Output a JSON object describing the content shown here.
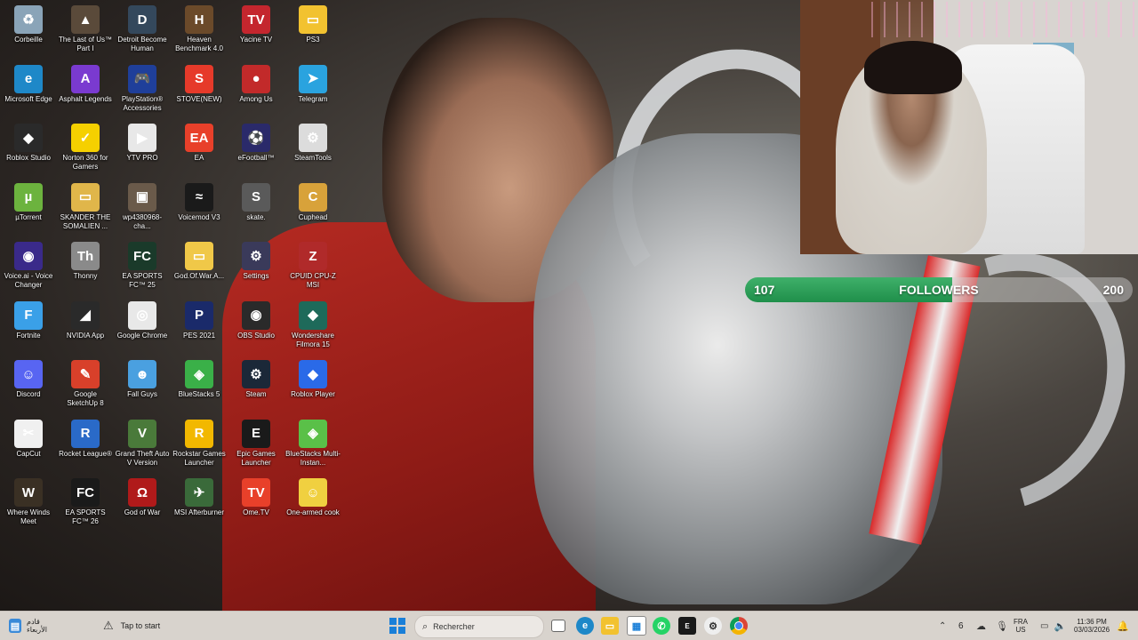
{
  "desktop_icons": [
    {
      "label": "Corbeille",
      "icon": "recycle-bin-icon",
      "color": "#8aa4b8",
      "glyph": "♻"
    },
    {
      "label": "The Last of Us™ Part I",
      "icon": "game-icon",
      "color": "#5a4a3a",
      "glyph": "▲"
    },
    {
      "label": "Detroit Become Human",
      "icon": "game-icon",
      "color": "#34485c",
      "glyph": "D"
    },
    {
      "label": "Heaven Benchmark 4.0",
      "icon": "benchmark-icon",
      "color": "#6b4a2a",
      "glyph": "H"
    },
    {
      "label": "Yacine TV",
      "icon": "tv-icon",
      "color": "#c4262e",
      "glyph": "TV"
    },
    {
      "label": "PS3",
      "icon": "folder-icon",
      "color": "#f2c230",
      "glyph": "▭"
    },
    {
      "label": "Microsoft Edge",
      "icon": "edge-icon",
      "color": "#1e88c8",
      "glyph": "e"
    },
    {
      "label": "Asphalt Legends",
      "icon": "game-icon",
      "color": "#7a3ad0",
      "glyph": "A"
    },
    {
      "label": "PlayStation® Accessories",
      "icon": "gamepad-icon",
      "color": "#1f3f9a",
      "glyph": "🎮"
    },
    {
      "label": "STOVE(NEW)",
      "icon": "stove-icon",
      "color": "#e63a2a",
      "glyph": "S"
    },
    {
      "label": "Among Us",
      "icon": "among-us-icon",
      "color": "#c22a2a",
      "glyph": "●"
    },
    {
      "label": "Telegram",
      "icon": "telegram-icon",
      "color": "#2aa3df",
      "glyph": "➤"
    },
    {
      "label": "Roblox Studio",
      "icon": "roblox-studio-icon",
      "color": "#2a2a2a",
      "glyph": "◆"
    },
    {
      "label": "Norton 360 for Gamers",
      "icon": "norton-icon",
      "color": "#f5d000",
      "glyph": "✓"
    },
    {
      "label": "YTV PRO",
      "icon": "ytv-icon",
      "color": "#e8e8e8",
      "glyph": "▶"
    },
    {
      "label": "EA",
      "icon": "ea-icon",
      "color": "#e8402a",
      "glyph": "EA"
    },
    {
      "label": "eFootball™",
      "icon": "efootball-icon",
      "color": "#2a2a6a",
      "glyph": "⚽"
    },
    {
      "label": "SteamTools",
      "icon": "steamtools-icon",
      "color": "#dcdcdc",
      "glyph": "⚙"
    },
    {
      "label": "µTorrent",
      "icon": "utorrent-icon",
      "color": "#6cb33e",
      "glyph": "µ"
    },
    {
      "label": "SKANDER THE SOMALIEN ...",
      "icon": "folder-icon",
      "color": "#e0b64a",
      "glyph": "▭"
    },
    {
      "label": "wp4380968-cha...",
      "icon": "image-file-icon",
      "color": "#6a5a4a",
      "glyph": "▣"
    },
    {
      "label": "Voicemod V3",
      "icon": "voicemod-icon",
      "color": "#1a1a1a",
      "glyph": "≈"
    },
    {
      "label": "skate.",
      "icon": "skate-icon",
      "color": "#5a5a5a",
      "glyph": "S"
    },
    {
      "label": "Cuphead",
      "icon": "cuphead-icon",
      "color": "#d8a23a",
      "glyph": "C"
    },
    {
      "label": "Voice.ai - Voice Changer",
      "icon": "voice-ai-icon",
      "color": "#3a2a8a",
      "glyph": "◉"
    },
    {
      "label": "Thonny",
      "icon": "thonny-icon",
      "color": "#8a8a8a",
      "glyph": "Th"
    },
    {
      "label": "EA SPORTS FC™ 25",
      "icon": "ea-fc-icon",
      "color": "#1a3a2a",
      "glyph": "FC"
    },
    {
      "label": "God.Of.War.A...",
      "icon": "folder-icon",
      "color": "#f0c848",
      "glyph": "▭"
    },
    {
      "label": "Settings",
      "icon": "settings-icon",
      "color": "#3a3a5a",
      "glyph": "⚙"
    },
    {
      "label": "CPUID CPU-Z MSI",
      "icon": "cpuz-icon",
      "color": "#b02a2a",
      "glyph": "Z"
    },
    {
      "label": "Fortnite",
      "icon": "fortnite-icon",
      "color": "#3aa0e8",
      "glyph": "F"
    },
    {
      "label": "NVIDIA App",
      "icon": "nvidia-icon",
      "color": "#2a2a2a",
      "glyph": "◢"
    },
    {
      "label": "Google Chrome",
      "icon": "chrome-icon",
      "color": "#e8e8e8",
      "glyph": "◎"
    },
    {
      "label": "PES 2021",
      "icon": "pes-icon",
      "color": "#1a2a6a",
      "glyph": "P"
    },
    {
      "label": "OBS Studio",
      "icon": "obs-icon",
      "color": "#2a2a2a",
      "glyph": "◉"
    },
    {
      "label": "Wondershare Filmora 15",
      "icon": "filmora-icon",
      "color": "#1e6a5a",
      "glyph": "◆"
    },
    {
      "label": "Discord",
      "icon": "discord-icon",
      "color": "#5865f2",
      "glyph": "☺"
    },
    {
      "label": "Google SketchUp 8",
      "icon": "sketchup-icon",
      "color": "#d8402a",
      "glyph": "✎"
    },
    {
      "label": "Fall Guys",
      "icon": "fall-guys-icon",
      "color": "#4aa0e0",
      "glyph": "☻"
    },
    {
      "label": "BlueStacks 5",
      "icon": "bluestacks-icon",
      "color": "#3ab048",
      "glyph": "◈"
    },
    {
      "label": "Steam",
      "icon": "steam-icon",
      "color": "#1b2838",
      "glyph": "⚙"
    },
    {
      "label": "Roblox Player",
      "icon": "roblox-icon",
      "color": "#2a6ae8",
      "glyph": "◆"
    },
    {
      "label": "CapCut",
      "icon": "capcut-icon",
      "color": "#f0f0f0",
      "glyph": "✂"
    },
    {
      "label": "Rocket League®",
      "icon": "rocket-league-icon",
      "color": "#2a6ac8",
      "glyph": "R"
    },
    {
      "label": "Grand Theft Auto V Version engin...",
      "icon": "gta-icon",
      "color": "#4a7a3a",
      "glyph": "V"
    },
    {
      "label": "Rockstar Games Launcher",
      "icon": "rockstar-icon",
      "color": "#f2b800",
      "glyph": "R"
    },
    {
      "label": "Epic Games Launcher",
      "icon": "epic-icon",
      "color": "#1a1a1a",
      "glyph": "E"
    },
    {
      "label": "BlueStacks Multi-Instan...",
      "icon": "bluestacks-multi-icon",
      "color": "#5ac048",
      "glyph": "◈"
    },
    {
      "label": "Where Winds Meet",
      "icon": "game-icon",
      "color": "#3a3024",
      "glyph": "W"
    },
    {
      "label": "EA SPORTS FC™ 26",
      "icon": "ea-fc-icon",
      "color": "#1a1a1a",
      "glyph": "FC"
    },
    {
      "label": "God of War",
      "icon": "god-of-war-icon",
      "color": "#b01a1a",
      "glyph": "Ω"
    },
    {
      "label": "MSI Afterburner",
      "icon": "afterburner-icon",
      "color": "#3a6a3a",
      "glyph": "✈"
    },
    {
      "label": "Ome.TV",
      "icon": "ome-tv-icon",
      "color": "#e8402a",
      "glyph": "TV"
    },
    {
      "label": "One-armed cook",
      "icon": "game-icon",
      "color": "#f0d040",
      "glyph": "☺"
    }
  ],
  "followers": {
    "current": "107",
    "label": "FOLLOWERS",
    "goal": "200",
    "progress": 0.535
  },
  "taskbar": {
    "weather_line1": "قادم",
    "weather_line2": "الأربعاء",
    "notification": "Tap to start",
    "search_label": "Rechercher",
    "lang_line1": "FRA",
    "lang_line2": "US",
    "time": "11:36 PM",
    "date": "03/03/2026",
    "tray_count": "6"
  }
}
